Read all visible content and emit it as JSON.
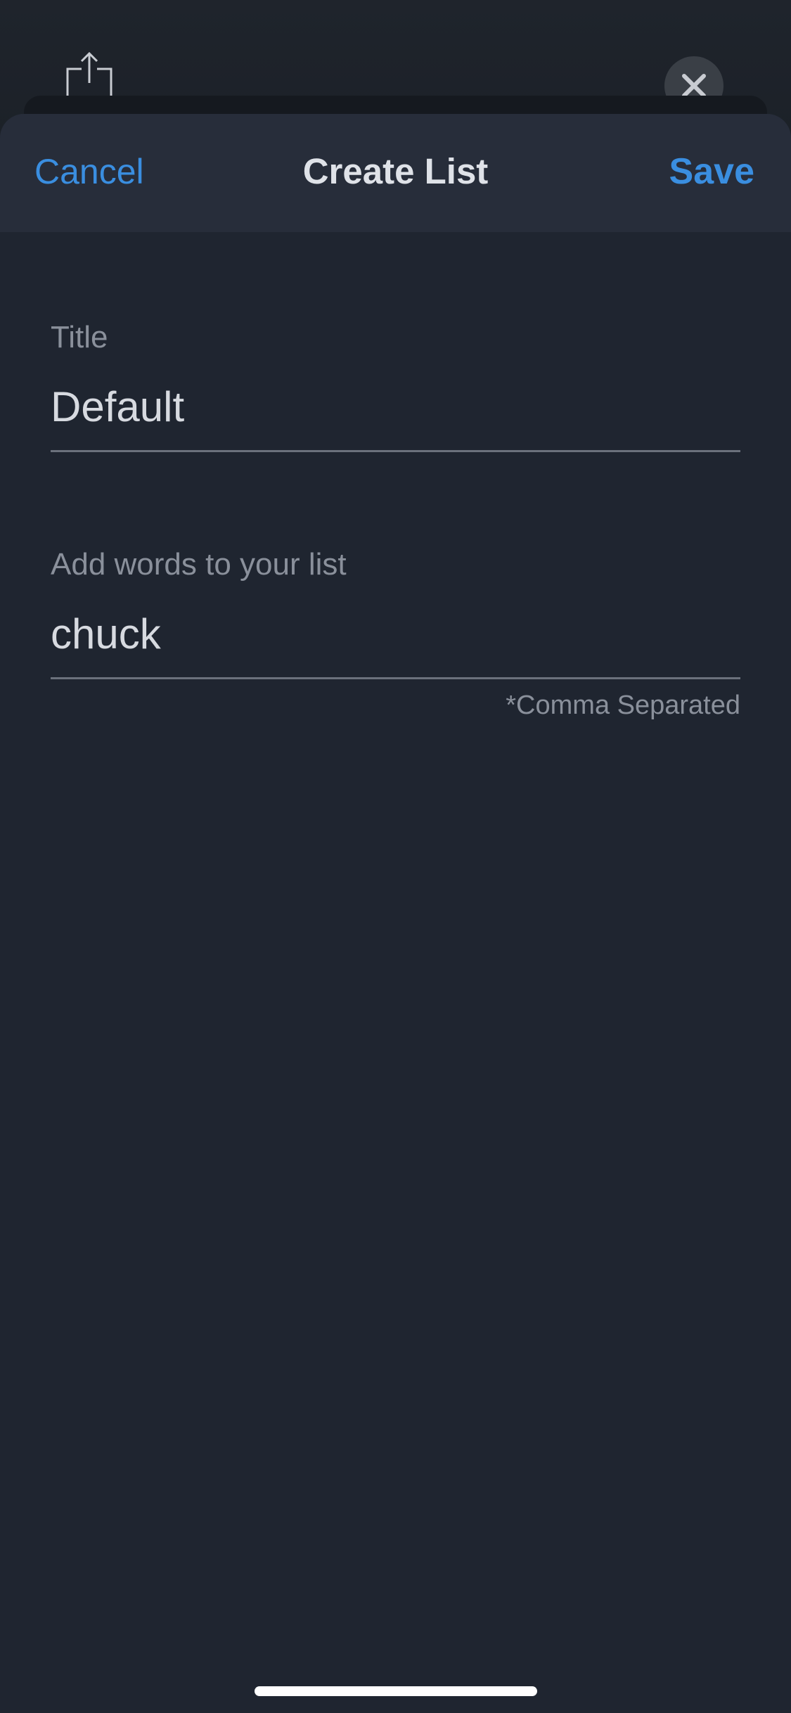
{
  "navbar": {
    "cancel_label": "Cancel",
    "title": "Create List",
    "save_label": "Save"
  },
  "form": {
    "title_field": {
      "label": "Title",
      "value": "Default"
    },
    "words_field": {
      "label": "Add words to your list",
      "value": "chuck",
      "hint": "*Comma Separated"
    }
  },
  "icons": {
    "share": "share-icon",
    "close": "close-icon"
  },
  "colors": {
    "accent": "#3a8ee0",
    "background": "#1f2530",
    "navbar": "#272d3a"
  }
}
